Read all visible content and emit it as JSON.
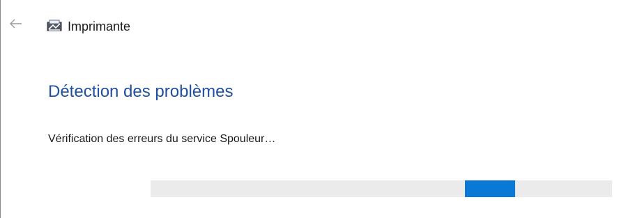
{
  "window": {
    "title": "Imprimante",
    "back_icon": "back-arrow-icon",
    "app_icon": "printer-icon"
  },
  "main": {
    "heading": "Détection des problèmes",
    "status": "Vérification des erreurs du service Spouleur…"
  },
  "progress": {
    "mode": "indeterminate",
    "segment_start": 0.682,
    "segment_length": 0.109
  },
  "colors": {
    "accent": "#0a78d7",
    "heading": "#1f4f9e",
    "track": "#ebebeb"
  }
}
